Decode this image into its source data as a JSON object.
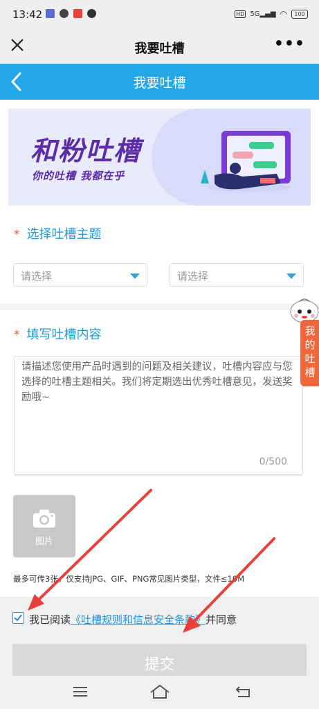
{
  "status_bar": {
    "time": "13:42",
    "network": "5G",
    "battery": "100",
    "icons": [
      "wifi-icon",
      "signal-icon",
      "battery-icon",
      "hd-icon"
    ]
  },
  "title_bar": {
    "title": "我要吐槽",
    "more_label": "•••"
  },
  "header": {
    "title": "我要吐槽"
  },
  "banner": {
    "headline": "和粉吐槽",
    "tagline": "你的吐槽  我都在乎"
  },
  "topic_section": {
    "required_mark": "*",
    "label": "选择吐槽主题",
    "select_1_placeholder": "请选择",
    "select_2_placeholder": "请选择"
  },
  "content_section": {
    "required_mark": "*",
    "label": "填写吐槽内容",
    "placeholder": "请描述您使用产品时遇到的问题及相关建议，吐槽内容应与您选择的吐槽主题相关。我们将定期选出优秀吐槽意见，发送奖励哦~",
    "counter": "0/500"
  },
  "upload": {
    "label": "图片",
    "hint": "最多可传3张，仅支持JPG、GIF、PNG常见图片类型，文件≤10M"
  },
  "agreement": {
    "checked": true,
    "prefix": "我已阅读",
    "link": "《吐槽规则和信息安全条款》",
    "suffix": "并同意"
  },
  "submit_label": "提交",
  "floating_tab": {
    "label": "我的吐槽"
  },
  "colors": {
    "accent": "#22a7ea",
    "required": "#e84a4a",
    "float_tab": "#f0673c",
    "banner_text": "#5b2ea8",
    "annotation_arrow": "#e8403a"
  }
}
